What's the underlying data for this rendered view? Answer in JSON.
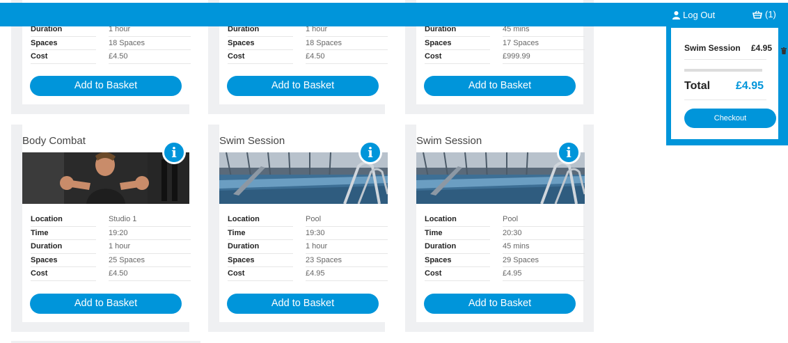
{
  "header": {
    "logout_label": "Log Out",
    "basket_count": "(1)",
    "icons": {
      "user": "user-icon",
      "basket": "basket-icon"
    },
    "color": "#0095da"
  },
  "labels": {
    "location": "Location",
    "time": "Time",
    "duration": "Duration",
    "spaces": "Spaces",
    "cost": "Cost",
    "add_to_basket": "Add to Basket"
  },
  "top_row": [
    {
      "duration": "1 hour",
      "spaces": "18 Spaces",
      "cost": "£4.50"
    },
    {
      "duration": "1 hour",
      "spaces": "18 Spaces",
      "cost": "£4.50"
    },
    {
      "duration": "45 mins",
      "spaces": "17 Spaces",
      "cost": "£999.99"
    }
  ],
  "classes": [
    {
      "title": "Body Combat",
      "location": "Studio 1",
      "time": "19:20",
      "duration": "1 hour",
      "spaces": "25 Spaces",
      "cost": "£4.50"
    },
    {
      "title": "Swim Session",
      "location": "Pool",
      "time": "19:30",
      "duration": "1 hour",
      "spaces": "23 Spaces",
      "cost": "£4.95"
    },
    {
      "title": "Swim Session",
      "location": "Pool",
      "time": "20:30",
      "duration": "45 mins",
      "spaces": "29 Spaces",
      "cost": "£4.95"
    }
  ],
  "basket": {
    "item_name": "Swim Session",
    "item_price": "£4.95",
    "total_label": "Total",
    "total_value": "£4.95",
    "checkout_label": "Checkout"
  }
}
